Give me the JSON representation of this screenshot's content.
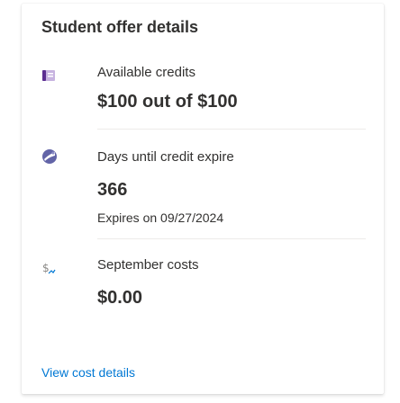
{
  "card": {
    "title": "Student offer details"
  },
  "credits": {
    "icon": "credit-card-icon",
    "label": "Available credits",
    "value": "$100 out of $100"
  },
  "expiry": {
    "icon": "credit-expiry-icon",
    "label": "Days until credit expire",
    "value": "366",
    "sub": "Expires on 09/27/2024"
  },
  "costs": {
    "icon": "cost-icon",
    "label": "September costs",
    "value": "$0.00"
  },
  "footer": {
    "link_label": "View cost details"
  },
  "colors": {
    "text": "#323130",
    "link": "#0078d4",
    "divider": "#edebe9",
    "credit_icon": "#5c2e91",
    "expiry_icon": "#6264a7",
    "cost_icon": "#8a8886"
  }
}
